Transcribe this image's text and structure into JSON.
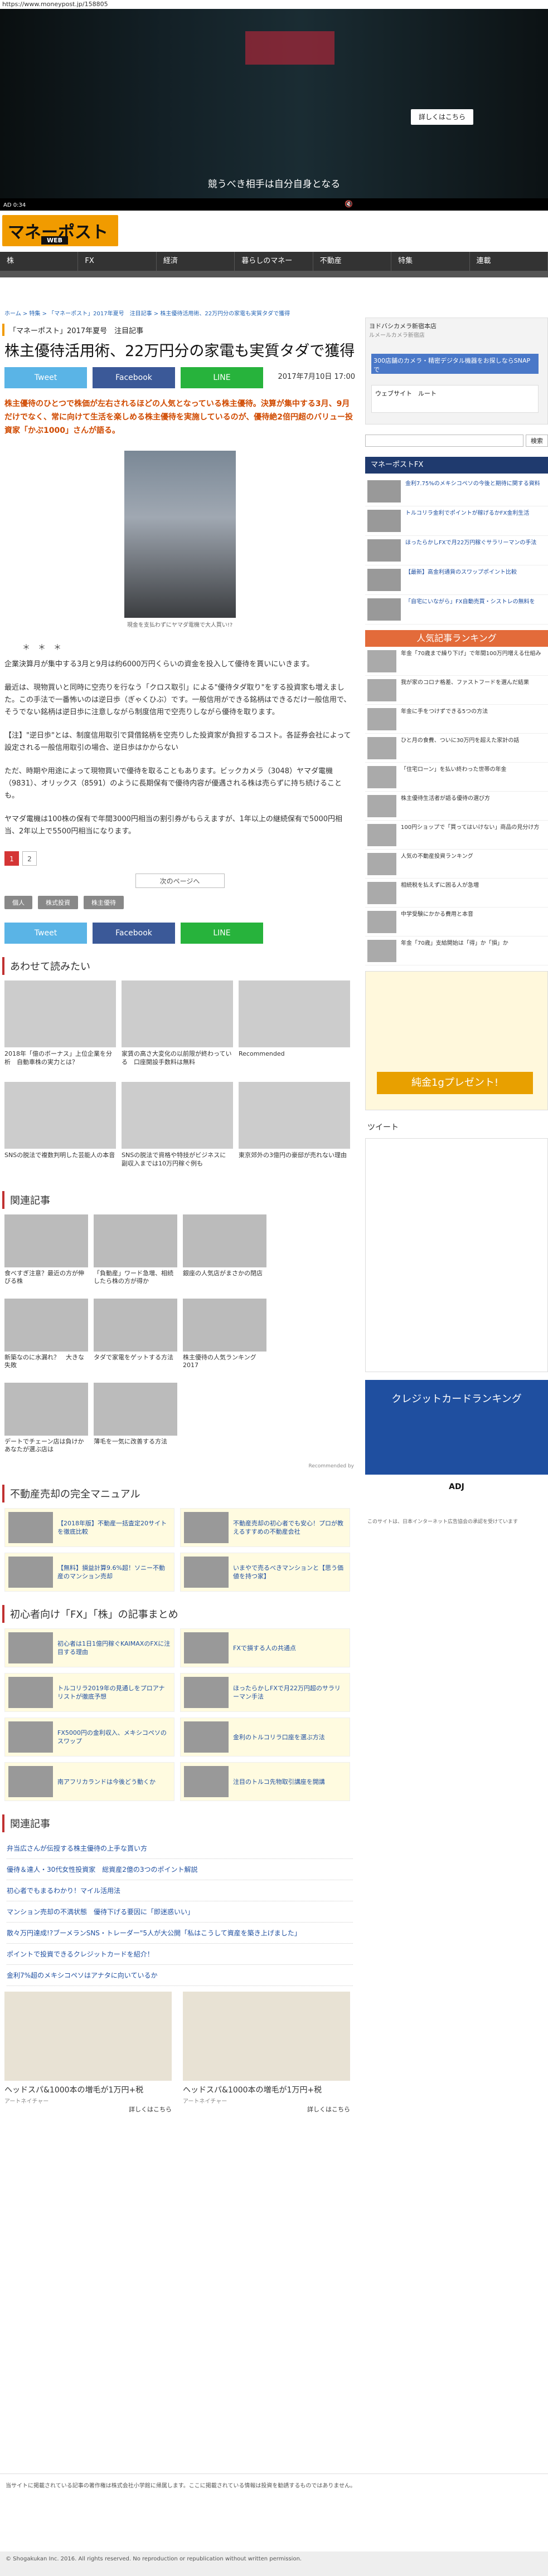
{
  "browser": {
    "url": "https://www.moneypost.jp/158805"
  },
  "video": {
    "button": "詳しくはこちら",
    "caption": "競うべき相手は自分自身となる",
    "time": "AD 0:34"
  },
  "logo": {
    "title": "マネーポスト",
    "web": "WEB"
  },
  "nav": [
    "株",
    "FX",
    "経済",
    "暮らしのマネー",
    "不動産",
    "特集",
    "連載"
  ],
  "breadcrumb": "ホーム > 特集 > 「マネーポスト」2017年夏号　注目記事 > 株主優待活用術、22万円分の家電も実質タダで獲得",
  "section": "「マネーポスト」2017年夏号　注目記事",
  "title": "株主優待活用術、22万円分の家電も実質タダで獲得",
  "share": {
    "tweet": "Tweet",
    "facebook": "Facebook",
    "line": "LINE"
  },
  "date": "2017年7月10日 17:00",
  "lead": "株主優待のひとつで株価が左右されるほどの人気となっている株主優待。決算が集中する3月、9月だけでなく、常に向けて生活を楽しめる株主優待を実施しているのが、優待絶2倍円超のバリュー投資家「かぶ1000」さんが語る。",
  "photo_caption": "現金を支払わずにヤマダ電機で大人買い!?",
  "dots": "＊　＊　＊",
  "paras": [
    "企業決算月が集中する3月と9月は約6000万円くらいの資金を投入して優待を貰いにいきます。",
    "最近は、現物買いと同時に空売りを行なう「クロス取引」による\"優待タダ取り\"をする投資家も増えました。この手法で一番怖いのは逆日歩（ぎゃくひぶ）です。一般信用ができる銘柄はできるだけ一般信用で、そうでない銘柄は逆日歩に注意しながら制度信用で空売りしながら優待を取ります。",
    "【注】\"逆日歩\"とは、制度信用取引で貸借銘柄を空売りした投資家が負担するコスト。各証券会社によって設定される一般信用取引の場合、逆日歩はかからない",
    "ただ、時期や用途によって現物買いで優待を取ることもあります。ビックカメラ（3048）ヤマダ電機（9831）、オリックス（8591）のように長期保有で優待内容が優遇される株は売らずに持ち続けることも。",
    "ヤマダ電機は100株の保有で年間3000円相当の割引券がもらえますが、1年以上の継続保有で5000円相当、2年以上で5500円相当になります。"
  ],
  "pager": {
    "pages": [
      "1",
      "2"
    ],
    "next": "次のページへ"
  },
  "tags": [
    "個人",
    "株式投資",
    "株主優待"
  ],
  "related_h": "あわせて読みたい",
  "related": [
    {
      "t": "2018年「億のボーナス」上位企業を分析　自動車株の実力とは？"
    },
    {
      "t": "家賃の高さ大変化の以前限が終わっている　口座開設手数料は無料"
    },
    {
      "t": "Recommended"
    },
    {
      "t": "SNSの脱法で複数判明した芸能人の本音"
    },
    {
      "t": "SNSの脱法で資格や特技がビジネスに　副収入までは10万円稼ぐ例も"
    },
    {
      "t": "東京郊外の3億円の豪邸が売れない理由"
    }
  ],
  "articles_h": "関連記事",
  "articles": [
    {
      "t": "食べすぎ注意？最近の方が伸びる株"
    },
    {
      "t": "「負動産」ワード急増、相続したら株の方が得か"
    },
    {
      "t": "銀座の人気店がまさかの閉店"
    },
    {
      "t": "新築なのに水漏れ？　大きな失敗"
    },
    {
      "t": "タダで家電をゲットする方法"
    },
    {
      "t": "株主優待の人気ランキング2017"
    },
    {
      "t": "デートでチェーン店は負けか　あなたが選ぶ店は"
    },
    {
      "t": "薄毛を一気に改善する方法"
    }
  ],
  "rec": "Recommended by",
  "manual_h": "不動産売却の完全マニュアル",
  "manual": [
    {
      "t": "【2018年版】不動産一括査定20サイトを徹底比較"
    },
    {
      "t": "不動産売却の初心者でも安心！プロが教えるすすめの不動産会社"
    },
    {
      "t": "【無料】損益計算9.6%超！ソニー不動産のマンション売却"
    },
    {
      "t": "いまやで売るべきマンションと【思う価値を持つ家】"
    }
  ],
  "fx_h": "初心者向け「FX」「株」の記事まとめ",
  "fx": [
    {
      "t": "初心者は1日1億円稼ぐKAIMAXのFXに注目する理由"
    },
    {
      "t": "FXで損する人の共通点"
    },
    {
      "t": "トルコリラ2019年の見通しをプロアナリストが徹底予想"
    },
    {
      "t": "ほったらかしFXで月22万円超のサラリーマン手法"
    },
    {
      "t": "FX5000円の金利収入、メキシコペソのスワップ"
    },
    {
      "t": "金利のトルコリラ口座を選ぶ方法"
    },
    {
      "t": "南アフリカランドは今後どう動くか"
    },
    {
      "t": "注目のトルコ先物取引講座を開講"
    }
  ],
  "links_h": "関連記事",
  "links": [
    "弁当広さんが伝授する株主優待の上手な貰い方",
    "優待＆達人・30代女性投資家　総資産2億の3つのポイント解説",
    "初心者でもまるわかり！マイル活用法",
    "マンション売却の不満状態　優待下げる要因に「即迷惑いい」",
    "散々万円達成!?ブーメランSNS・トレーダー\"5人が大公開「私はこうして資産を築き上げました」",
    "ポイントで投資できるクレジットカードを紹介！",
    "金利7%超のメキシコペソはアナタに向いているか"
  ],
  "ads": [
    {
      "cap": "ヘッドスパ&1000本の増毛が1万円+税",
      "sub": "アートネイチャー",
      "more": "詳しくはこちら"
    },
    {
      "cap": "ヘッドスパ&1000本の増毛が1万円+税",
      "sub": "アートネイチャー",
      "more": "詳しくはこちら"
    }
  ],
  "footer": "当サイトに掲載されている記事の著作権は株式会社小学館に帰属します。ここに掲載されている情報は投資を勧誘するものではありません。",
  "copyright": "© Shogakukan Inc. 2016. All rights reserved. No reproduction or republication without written permission.",
  "side": {
    "map_t1": "ヨドバシカメラ新宿本店",
    "map_t2": "ルメールカメラ新宿店",
    "map_t3": "300店舗のカメラ・精密デジタル機器をお探しならSNAPで",
    "map_loc": "ウェブサイト　ルート",
    "search": "検索",
    "fx_h": "マネーポストFX",
    "fx": [
      {
        "t": "金利7.75%のメキシコペソの今後と期待に関する資料"
      },
      {
        "t": "トルコリラ金利でポイントが稼げるかFX金利生活"
      },
      {
        "t": "ほったらかしFXで月22万円稼ぐサラリーマンの手法"
      },
      {
        "t": "【最新】高金利通貨のスワップポイント比較"
      },
      {
        "t": "「自宅にいながら」FX自動売買・シストレの無料を"
      }
    ],
    "rank_h": "人気記事ランキング",
    "rank": [
      {
        "t": "年金「70歳まで繰り下げ」で年間100万円増える仕組み"
      },
      {
        "t": "我が家のコロナ格差、ファストフードを選んだ結果"
      },
      {
        "t": "年金に手をつけずできる5つの方法"
      },
      {
        "t": "ひと月の食費、ついに30万円を超えた家計の話"
      },
      {
        "t": "「住宅ローン」を払い終わった世帯の年金"
      },
      {
        "t": "株主優待生活者が語る優待の選び方"
      },
      {
        "t": "100円ショップで「買ってはいけない」商品の見分け方"
      },
      {
        "t": "人気の不動産投資ランキング"
      },
      {
        "t": "相続税を払えずに困る人が急増"
      },
      {
        "t": "中学受験にかかる費用と本音"
      },
      {
        "t": "年金「70歳」支給開始は「得」か「損」か"
      }
    ],
    "ad_text": "純金1gプレゼント!",
    "ad_more": "詳しくはこちら",
    "tweet_h": "ツイート",
    "cc": "クレジットカードランキング",
    "adj": "ADJ",
    "adj_tx": "このサイトは、日本インターネット広告協会の承認を受けています"
  }
}
